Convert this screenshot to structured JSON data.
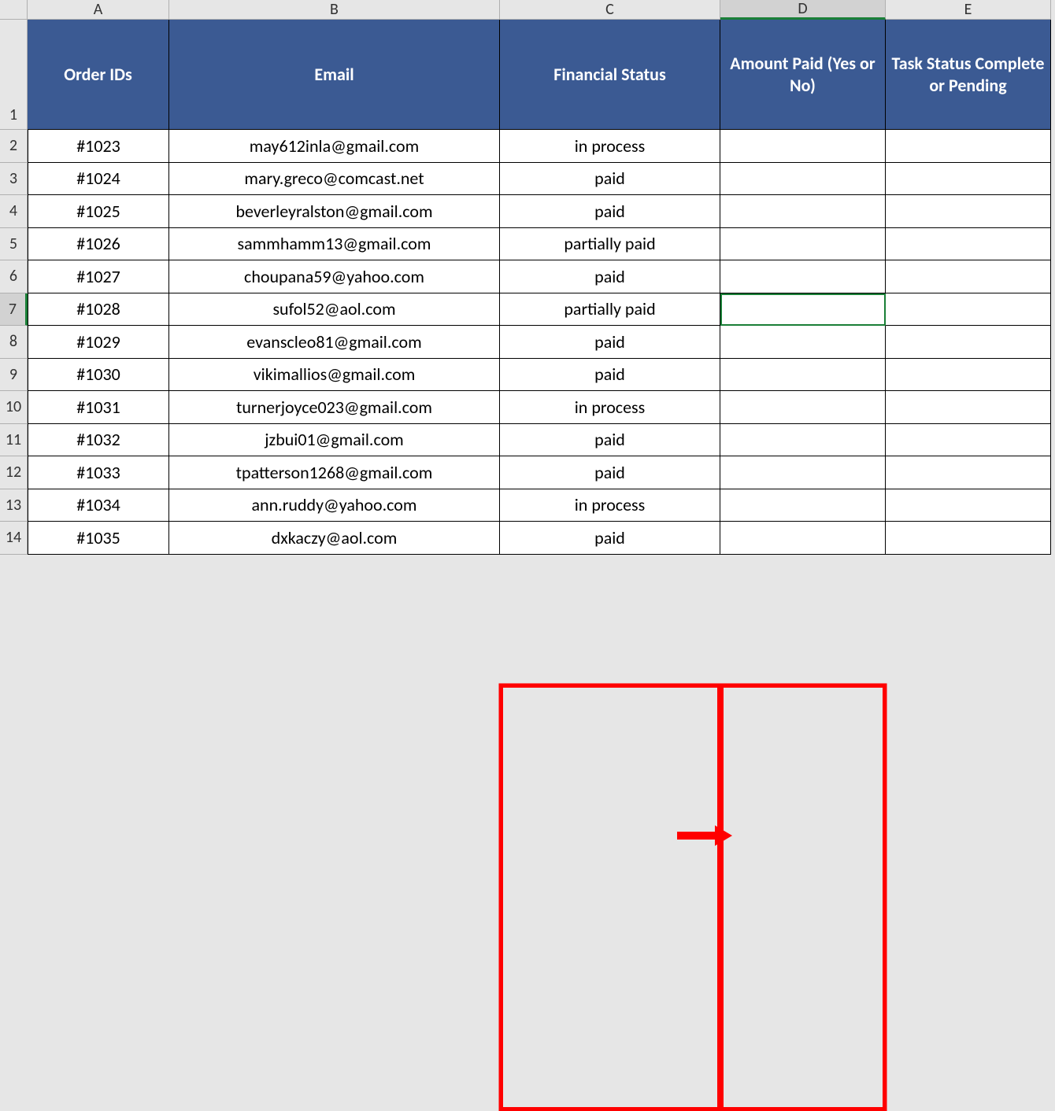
{
  "columns": [
    "A",
    "B",
    "C",
    "D",
    "E"
  ],
  "rows": [
    "1",
    "2",
    "3",
    "4",
    "5",
    "6",
    "7",
    "8",
    "9",
    "10",
    "11",
    "12",
    "13",
    "14"
  ],
  "headers": {
    "A": "Order IDs",
    "B": "Email",
    "C": "Financial Status",
    "D": "Amount Paid (Yes or No)",
    "E": "Task Status Complete or Pending"
  },
  "data": [
    {
      "r": "2",
      "A": "#1023",
      "B": "may612inla@gmail.com",
      "C": "in process",
      "D": "",
      "E": ""
    },
    {
      "r": "3",
      "A": "#1024",
      "B": "mary.greco@comcast.net",
      "C": "paid",
      "D": "",
      "E": ""
    },
    {
      "r": "4",
      "A": "#1025",
      "B": "beverleyralston@gmail.com",
      "C": "paid",
      "D": "",
      "E": ""
    },
    {
      "r": "5",
      "A": "#1026",
      "B": "sammhamm13@gmail.com",
      "C": "partially paid",
      "D": "",
      "E": ""
    },
    {
      "r": "6",
      "A": "#1027",
      "B": "choupana59@yahoo.com",
      "C": "paid",
      "D": "",
      "E": ""
    },
    {
      "r": "7",
      "A": "#1028",
      "B": "sufol52@aol.com",
      "C": "partially paid",
      "D": "",
      "E": ""
    },
    {
      "r": "8",
      "A": "#1029",
      "B": "evanscleo81@gmail.com",
      "C": "paid",
      "D": "",
      "E": ""
    },
    {
      "r": "9",
      "A": "#1030",
      "B": "vikimallios@gmail.com",
      "C": "paid",
      "D": "",
      "E": ""
    },
    {
      "r": "10",
      "A": "#1031",
      "B": "turnerjoyce023@gmail.com",
      "C": "in process",
      "D": "",
      "E": ""
    },
    {
      "r": "11",
      "A": "#1032",
      "B": "jzbui01@gmail.com",
      "C": "paid",
      "D": "",
      "E": ""
    },
    {
      "r": "12",
      "A": "#1033",
      "B": "tpatterson1268@gmail.com",
      "C": "paid",
      "D": "",
      "E": ""
    },
    {
      "r": "13",
      "A": "#1034",
      "B": "ann.ruddy@yahoo.com",
      "C": "in process",
      "D": "",
      "E": ""
    },
    {
      "r": "14",
      "A": "#1035",
      "B": "dxkaczy@aol.com",
      "C": "paid",
      "D": "",
      "E": ""
    }
  ],
  "selected_cell": "D7",
  "highlighted_columns": [
    "C",
    "D"
  ]
}
